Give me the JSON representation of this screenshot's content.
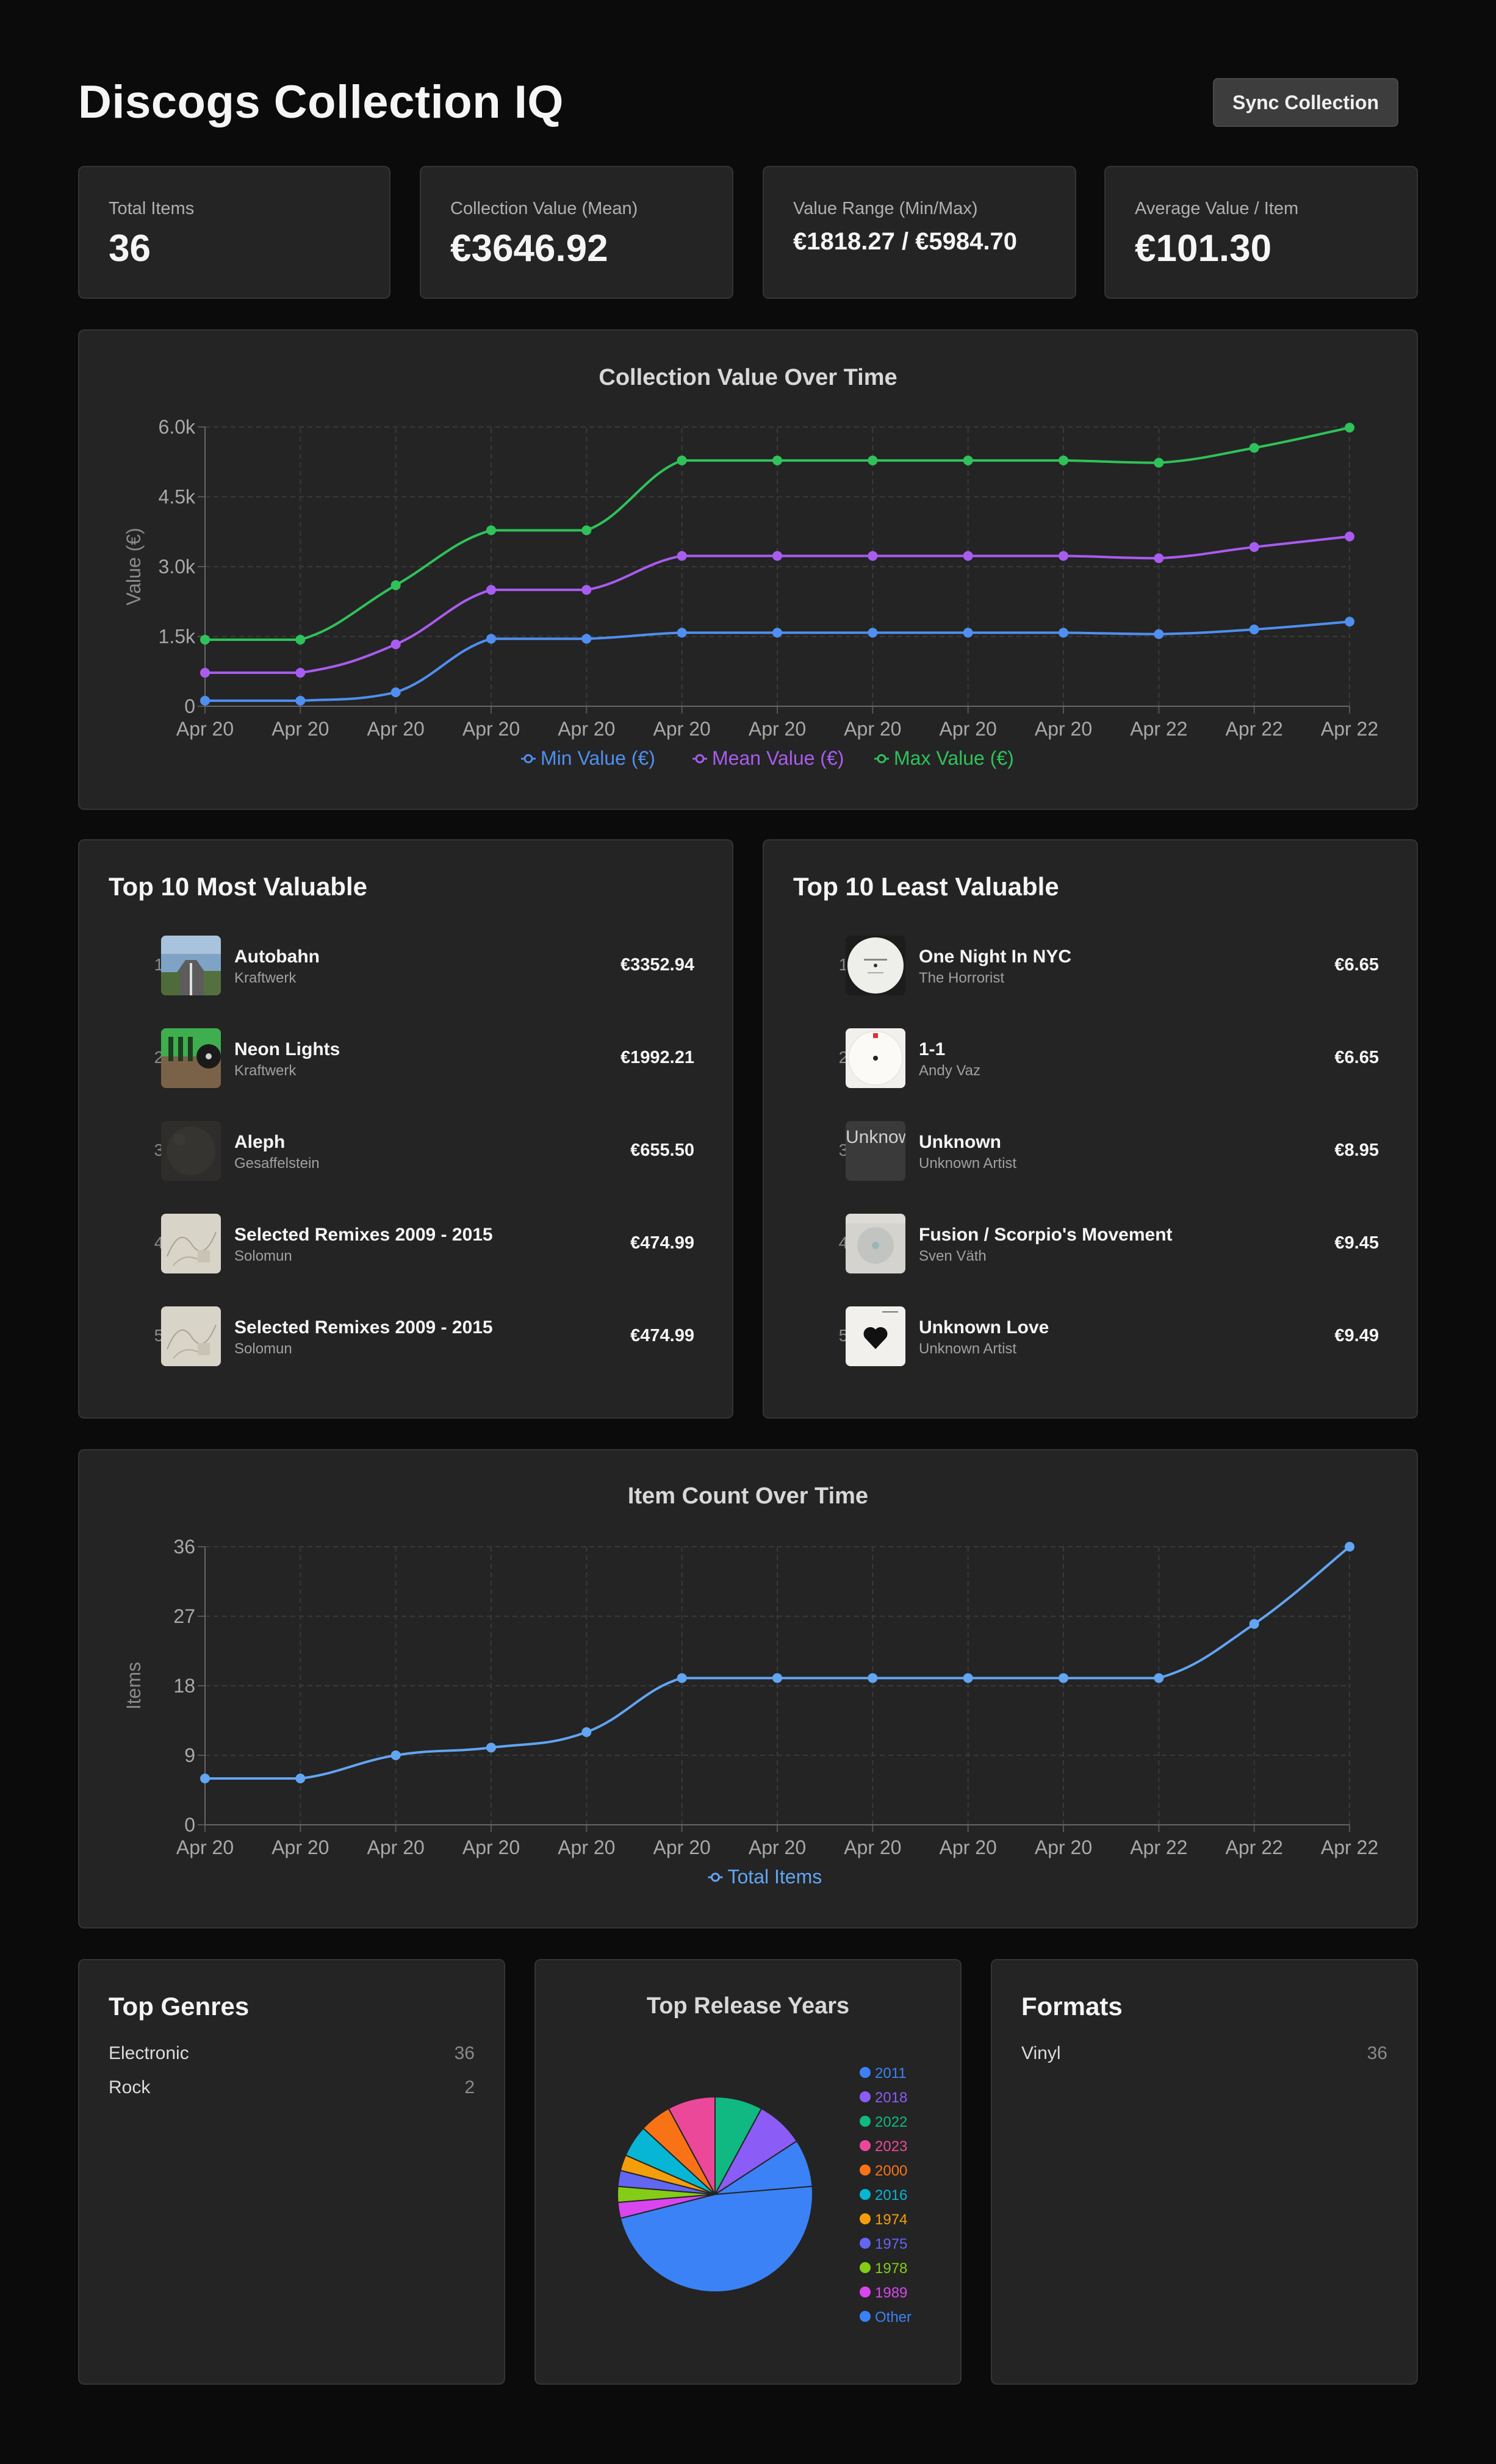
{
  "header": {
    "title": "Discogs Collection IQ",
    "sync_label": "Sync Collection"
  },
  "stats": [
    {
      "label": "Total Items",
      "value": "36"
    },
    {
      "label": "Collection Value (Mean)",
      "value": "€3646.92"
    },
    {
      "label": "Value Range (Min/Max)",
      "value": "€1818.27 / €5984.70"
    },
    {
      "label": "Average Value / Item",
      "value": "€101.30"
    }
  ],
  "value_chart": {
    "title": "Collection Value Over Time",
    "ylabel": "Value (€)",
    "y_ticks": [
      "0",
      "1.5k",
      "3.0k",
      "4.5k",
      "6.0k"
    ],
    "x_ticks": [
      "Apr 20",
      "Apr 20",
      "Apr 20",
      "Apr 20",
      "Apr 20",
      "Apr 20",
      "Apr 20",
      "Apr 20",
      "Apr 20",
      "Apr 20",
      "Apr 22",
      "Apr 22",
      "Apr 22"
    ],
    "legend": [
      "Min Value (€)",
      "Mean Value (€)",
      "Max Value (€)"
    ]
  },
  "count_chart": {
    "title": "Item Count Over Time",
    "ylabel": "Items",
    "y_ticks": [
      "0",
      "9",
      "18",
      "27",
      "36"
    ],
    "x_ticks": [
      "Apr 20",
      "Apr 20",
      "Apr 20",
      "Apr 20",
      "Apr 20",
      "Apr 20",
      "Apr 20",
      "Apr 20",
      "Apr 20",
      "Apr 20",
      "Apr 22",
      "Apr 22",
      "Apr 22"
    ],
    "legend": [
      "Total Items"
    ]
  },
  "most_valuable": {
    "title": "Top 10 Most Valuable",
    "items": [
      {
        "rank": "1.",
        "name": "Autobahn",
        "artist": "Kraftwerk",
        "price": "€3352.94"
      },
      {
        "rank": "2.",
        "name": "Neon Lights",
        "artist": "Kraftwerk",
        "price": "€1992.21"
      },
      {
        "rank": "3.",
        "name": "Aleph",
        "artist": "Gesaffelstein",
        "price": "€655.50"
      },
      {
        "rank": "4.",
        "name": "Selected Remixes 2009 - 2015",
        "artist": "Solomun",
        "price": "€474.99"
      },
      {
        "rank": "5.",
        "name": "Selected Remixes 2009 - 2015",
        "artist": "Solomun",
        "price": "€474.99"
      }
    ]
  },
  "least_valuable": {
    "title": "Top 10 Least Valuable",
    "items": [
      {
        "rank": "1.",
        "name": "One Night In NYC",
        "artist": "The Horrorist",
        "price": "€6.65"
      },
      {
        "rank": "2.",
        "name": "1-1",
        "artist": "Andy Vaz",
        "price": "€6.65"
      },
      {
        "rank": "3.",
        "name": "Unknown",
        "artist": "Unknown Artist",
        "price": "€8.95",
        "broken_image_alt": "Unknown"
      },
      {
        "rank": "4.",
        "name": "Fusion / Scorpio's Movement",
        "artist": "Sven Väth",
        "price": "€9.45"
      },
      {
        "rank": "5.",
        "name": "Unknown Love",
        "artist": "Unknown Artist",
        "price": "€9.49"
      }
    ]
  },
  "genres": {
    "title": "Top Genres",
    "items": [
      {
        "label": "Electronic",
        "count": "36"
      },
      {
        "label": "Rock",
        "count": "2"
      }
    ]
  },
  "formats": {
    "title": "Formats",
    "items": [
      {
        "label": "Vinyl",
        "count": "36"
      }
    ]
  },
  "years": {
    "title": "Top Release Years"
  },
  "colors": {
    "min": "#4f8ff0",
    "mean": "#a95cf0",
    "max": "#2fc25a",
    "count": "#62a5f2"
  },
  "chart_data": [
    {
      "type": "line",
      "title": "Collection Value Over Time",
      "ylabel": "Value (€)",
      "x": [
        "Apr 20",
        "Apr 20",
        "Apr 20",
        "Apr 20",
        "Apr 20",
        "Apr 20",
        "Apr 20",
        "Apr 20",
        "Apr 20",
        "Apr 20",
        "Apr 22",
        "Apr 22",
        "Apr 22"
      ],
      "ylim": [
        0,
        6000
      ],
      "grid": true,
      "legend": "bottom",
      "series": [
        {
          "name": "Min Value (€)",
          "values": [
            120,
            120,
            300,
            1450,
            1450,
            1580,
            1580,
            1580,
            1580,
            1580,
            1550,
            1650,
            1818
          ]
        },
        {
          "name": "Mean Value (€)",
          "values": [
            720,
            720,
            1330,
            2500,
            2500,
            3230,
            3230,
            3230,
            3230,
            3230,
            3180,
            3420,
            3647
          ]
        },
        {
          "name": "Max Value (€)",
          "values": [
            1430,
            1430,
            2600,
            3780,
            3780,
            5280,
            5280,
            5280,
            5280,
            5280,
            5230,
            5550,
            5985
          ]
        }
      ]
    },
    {
      "type": "line",
      "title": "Item Count Over Time",
      "ylabel": "Items",
      "x": [
        "Apr 20",
        "Apr 20",
        "Apr 20",
        "Apr 20",
        "Apr 20",
        "Apr 20",
        "Apr 20",
        "Apr 20",
        "Apr 20",
        "Apr 20",
        "Apr 22",
        "Apr 22",
        "Apr 22"
      ],
      "ylim": [
        0,
        36
      ],
      "grid": true,
      "legend": "bottom",
      "series": [
        {
          "name": "Total Items",
          "values": [
            6,
            6,
            9,
            10,
            12,
            19,
            19,
            19,
            19,
            19,
            19,
            26,
            36
          ]
        }
      ]
    },
    {
      "type": "pie",
      "title": "Top Release Years",
      "legend": "right",
      "categories": [
        "2011",
        "2018",
        "2022",
        "2023",
        "2000",
        "2016",
        "1974",
        "1975",
        "1978",
        "1989",
        "Other"
      ],
      "values": [
        3,
        3,
        3,
        3,
        2,
        2,
        1,
        1,
        1,
        1,
        18
      ],
      "colors": [
        "#3b82f6",
        "#8b5cf6",
        "#10b981",
        "#ec4899",
        "#f97316",
        "#06b6d4",
        "#f59e0b",
        "#6366f1",
        "#84cc16",
        "#d946ef",
        "#3b82f6"
      ]
    }
  ]
}
